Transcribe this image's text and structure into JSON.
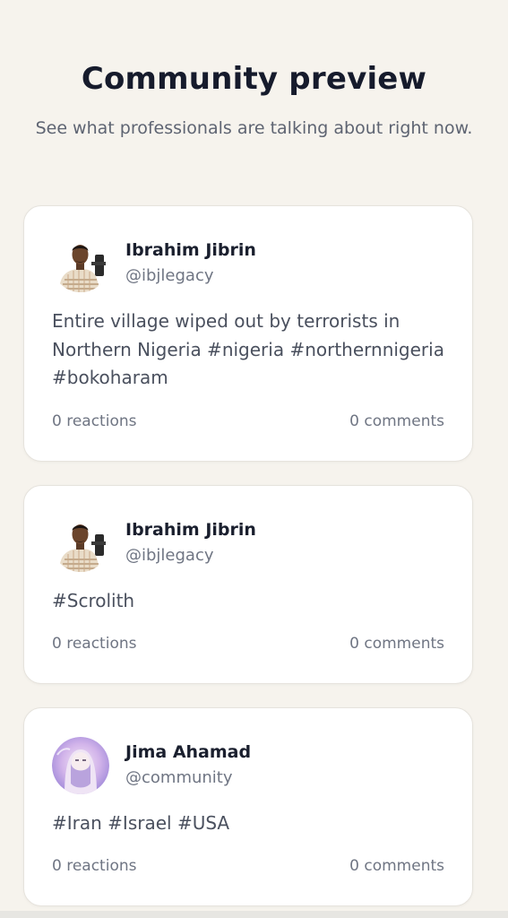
{
  "section": {
    "title": "Community preview",
    "subtitle": "See what professionals are talking about right now."
  },
  "posts": [
    {
      "author": "Ibrahim Jibrin",
      "handle": "@ibjlegacy",
      "avatar_icon": "person-photo-striped-shirt",
      "body": "Entire village wiped out by terrorists in Northern Nigeria #nigeria #northernnigeria #bokoharam",
      "reactions": "0 reactions",
      "comments": "0 comments"
    },
    {
      "author": "Ibrahim Jibrin",
      "handle": "@ibjlegacy",
      "avatar_icon": "person-photo-striped-shirt",
      "body": "#Scrolith",
      "reactions": "0 reactions",
      "comments": "0 comments"
    },
    {
      "author": "Jima Ahamad",
      "handle": "@community",
      "avatar_icon": "person-photo-purple-veil",
      "body": "#Iran #Israel #USA",
      "reactions": "0 reactions",
      "comments": "0 comments"
    }
  ],
  "colors": {
    "background": "#f6f3ed",
    "card": "#ffffff",
    "heading": "#161b2c",
    "muted": "#6f7583"
  }
}
